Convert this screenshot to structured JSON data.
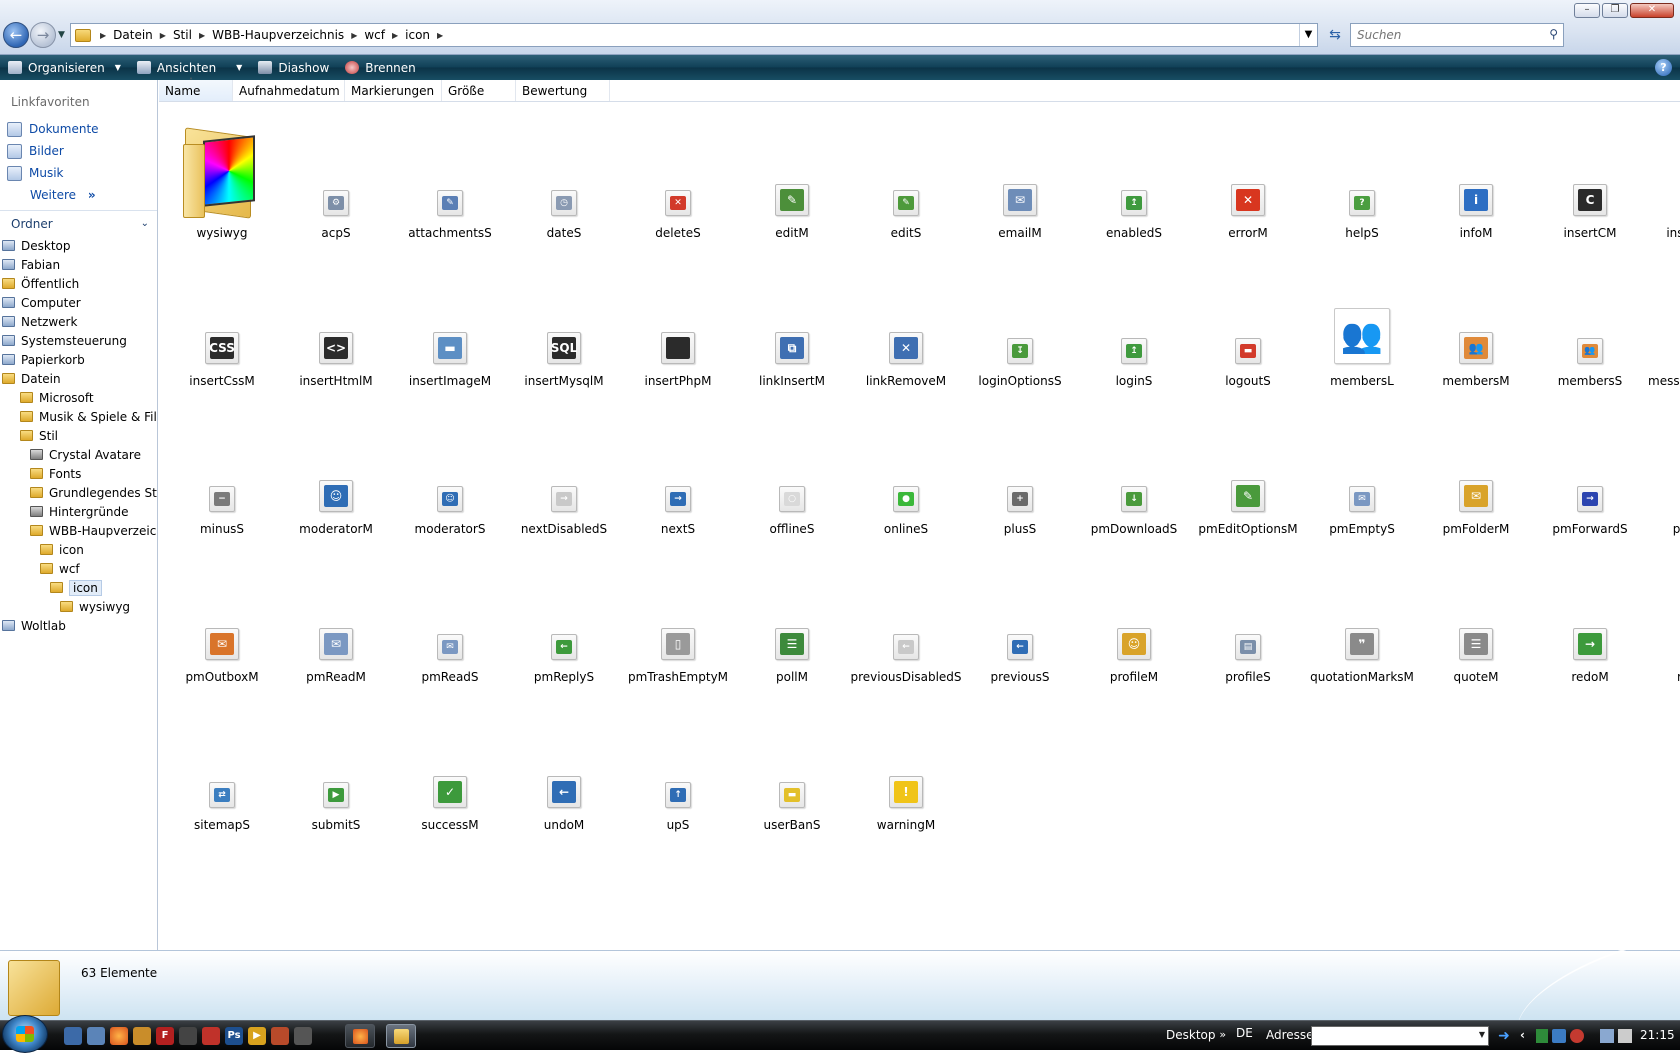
{
  "window": {
    "breadcrumbs": [
      "Datein",
      "Stil",
      "WBB-Haupverzeichnis",
      "wcf",
      "icon"
    ],
    "search_placeholder": "Suchen"
  },
  "toolbar": {
    "organize": "Organisieren",
    "views": "Ansichten",
    "slideshow": "Diashow",
    "burn": "Brennen"
  },
  "sidebar": {
    "favorites_heading": "Linkfavoriten",
    "favorites": [
      {
        "label": "Dokumente",
        "icon": "documents-icon"
      },
      {
        "label": "Bilder",
        "icon": "pictures-icon"
      },
      {
        "label": "Musik",
        "icon": "music-icon"
      }
    ],
    "more_label": "Weitere",
    "more_glyph": "»",
    "folders_heading": "Ordner",
    "tree": [
      {
        "label": "Desktop",
        "indent": 0,
        "icon": "sys"
      },
      {
        "label": "Fabian",
        "indent": 0,
        "icon": "sys"
      },
      {
        "label": "Öffentlich",
        "indent": 0,
        "icon": "folder"
      },
      {
        "label": "Computer",
        "indent": 0,
        "icon": "sys"
      },
      {
        "label": "Netzwerk",
        "indent": 0,
        "icon": "sys"
      },
      {
        "label": "Systemsteuerung",
        "indent": 0,
        "icon": "sys"
      },
      {
        "label": "Papierkorb",
        "indent": 0,
        "icon": "sys"
      },
      {
        "label": "Datein",
        "indent": 0,
        "icon": "folder"
      },
      {
        "label": "Microsoft",
        "indent": 1,
        "icon": "folder"
      },
      {
        "label": "Musik & Spiele & Film",
        "indent": 1,
        "icon": "folder"
      },
      {
        "label": "Stil",
        "indent": 1,
        "icon": "folder"
      },
      {
        "label": "Crystal Avatare",
        "indent": 2,
        "icon": "img"
      },
      {
        "label": "Fonts",
        "indent": 2,
        "icon": "folder"
      },
      {
        "label": "Grundlegendes Stil",
        "indent": 2,
        "icon": "folder"
      },
      {
        "label": "Hintergründe",
        "indent": 2,
        "icon": "img"
      },
      {
        "label": "WBB-Haupverzeichnis",
        "indent": 2,
        "icon": "folder"
      },
      {
        "label": "icon",
        "indent": 3,
        "icon": "folder"
      },
      {
        "label": "wcf",
        "indent": 3,
        "icon": "folder"
      },
      {
        "label": "icon",
        "indent": 4,
        "icon": "folder",
        "selected": true
      },
      {
        "label": "wysiwyg",
        "indent": 5,
        "icon": "folder"
      },
      {
        "label": "Woltlab",
        "indent": 0,
        "icon": "sys"
      }
    ]
  },
  "columns": [
    "Name",
    "Aufnahmedatum",
    "Markierungen",
    "Größe",
    "Bewertung"
  ],
  "files": [
    {
      "name": "wysiwyg",
      "kind": "folder"
    },
    {
      "name": "acpS",
      "color": "#7d8fa8",
      "glyph": "⚙"
    },
    {
      "name": "attachmentsS",
      "color": "#5b7fb5",
      "glyph": "✎"
    },
    {
      "name": "dateS",
      "color": "#8a9ab2",
      "glyph": "◷"
    },
    {
      "name": "deleteS",
      "color": "#d23a2a",
      "glyph": "✕"
    },
    {
      "name": "editM",
      "color": "#4c8f3a",
      "glyph": "✎",
      "size": "m"
    },
    {
      "name": "editS",
      "color": "#4e9a3b",
      "glyph": "✎"
    },
    {
      "name": "emailM",
      "color": "#6e8db8",
      "glyph": "✉",
      "size": "m"
    },
    {
      "name": "enabledS",
      "color": "#3f9a3e",
      "glyph": "↥"
    },
    {
      "name": "errorM",
      "color": "#d8361f",
      "glyph": "✕",
      "size": "m"
    },
    {
      "name": "helpS",
      "color": "#4a9e3f",
      "glyph": "?"
    },
    {
      "name": "infoM",
      "color": "#2d6ec3",
      "glyph": "i",
      "size": "m"
    },
    {
      "name": "insertCM",
      "color": "#2b2b2b",
      "glyph": "C",
      "size": "m"
    },
    {
      "name": "insertCodeM",
      "color": "#2b2b2b",
      "glyph": "#",
      "size": "m"
    },
    {
      "name": "insertCssM",
      "color": "#2b2b2b",
      "glyph": "CSS",
      "size": "m"
    },
    {
      "name": "insertHtmlM",
      "color": "#2b2b2b",
      "glyph": "<>",
      "size": "m"
    },
    {
      "name": "insertImageM",
      "color": "#5d8fc4",
      "glyph": "▬",
      "size": "m"
    },
    {
      "name": "insertMysqlM",
      "color": "#2b2b2b",
      "glyph": "SQL",
      "size": "m"
    },
    {
      "name": "insertPhpM",
      "color": "#2b2b2b",
      "glyph": "<?",
      "size": "m"
    },
    {
      "name": "linkInsertM",
      "color": "#3f6fb2",
      "glyph": "⧉",
      "size": "m"
    },
    {
      "name": "linkRemoveM",
      "color": "#3f6fb2",
      "glyph": "✕",
      "size": "m"
    },
    {
      "name": "loginOptionsS",
      "color": "#4a9a3c",
      "glyph": "↧"
    },
    {
      "name": "loginS",
      "color": "#3f9a3e",
      "glyph": "↥"
    },
    {
      "name": "logoutS",
      "color": "#d23a2a",
      "glyph": "▬"
    },
    {
      "name": "membersL",
      "color": "#e08a3a",
      "glyph": "👥",
      "size": "big"
    },
    {
      "name": "membersM",
      "color": "#e08a3a",
      "glyph": "👥",
      "size": "m"
    },
    {
      "name": "membersS",
      "color": "#e08a3a",
      "glyph": "👥"
    },
    {
      "name": "messageQuoteOpt...",
      "color": "#888888",
      "glyph": "▾"
    },
    {
      "name": "minusS",
      "color": "#7b7b7b",
      "glyph": "−"
    },
    {
      "name": "moderatorM",
      "color": "#2f6db5",
      "glyph": "☺",
      "size": "m"
    },
    {
      "name": "moderatorS",
      "color": "#2f6db5",
      "glyph": "☺"
    },
    {
      "name": "nextDisabledS",
      "color": "#c9c9c9",
      "glyph": "→"
    },
    {
      "name": "nextS",
      "color": "#2f6db5",
      "glyph": "→"
    },
    {
      "name": "offlineS",
      "color": "#d9d9d9",
      "glyph": "○"
    },
    {
      "name": "onlineS",
      "color": "#3bb83a",
      "glyph": "●"
    },
    {
      "name": "plusS",
      "color": "#6b6b6b",
      "glyph": "+"
    },
    {
      "name": "pmDownloadS",
      "color": "#4a9a3c",
      "glyph": "↓"
    },
    {
      "name": "pmEditOptionsM",
      "color": "#4a9a3c",
      "glyph": "✎",
      "size": "m"
    },
    {
      "name": "pmEmptyS",
      "color": "#7b98c2",
      "glyph": "✉"
    },
    {
      "name": "pmFolderM",
      "color": "#d9a32a",
      "glyph": "✉",
      "size": "m"
    },
    {
      "name": "pmForwardS",
      "color": "#2c45b0",
      "glyph": "→"
    },
    {
      "name": "pmInboxM",
      "color": "#3d9a3c",
      "glyph": "✉",
      "size": "m"
    },
    {
      "name": "pmOutboxM",
      "color": "#d9742a",
      "glyph": "✉",
      "size": "m"
    },
    {
      "name": "pmReadM",
      "color": "#7b98c2",
      "glyph": "✉",
      "size": "m"
    },
    {
      "name": "pmReadS",
      "color": "#7b98c2",
      "glyph": "✉"
    },
    {
      "name": "pmReplyS",
      "color": "#3d9a3c",
      "glyph": "←"
    },
    {
      "name": "pmTrashEmptyM",
      "color": "#9a9a9a",
      "glyph": "▯",
      "size": "m"
    },
    {
      "name": "pollM",
      "color": "#3d8a3c",
      "glyph": "☰",
      "size": "m"
    },
    {
      "name": "previousDisabledS",
      "color": "#c9c9c9",
      "glyph": "←"
    },
    {
      "name": "previousS",
      "color": "#2f6db5",
      "glyph": "←"
    },
    {
      "name": "profileM",
      "color": "#d9a32a",
      "glyph": "☺",
      "size": "m"
    },
    {
      "name": "profileS",
      "color": "#7b8faa",
      "glyph": "▤"
    },
    {
      "name": "quotationMarksM",
      "color": "#8a8a8a",
      "glyph": "❞",
      "size": "m"
    },
    {
      "name": "quoteM",
      "color": "#8a8a8a",
      "glyph": "☰",
      "size": "m"
    },
    {
      "name": "redoM",
      "color": "#3d9a3c",
      "glyph": "→",
      "size": "m"
    },
    {
      "name": "registerS",
      "color": "#d9742a",
      "glyph": "✎"
    },
    {
      "name": "sitemapS",
      "color": "#3b7ec0",
      "glyph": "⇄"
    },
    {
      "name": "submitS",
      "color": "#3d9a3c",
      "glyph": "▶"
    },
    {
      "name": "successM",
      "color": "#3d9a3c",
      "glyph": "✓",
      "size": "m"
    },
    {
      "name": "undoM",
      "color": "#2f6db5",
      "glyph": "←",
      "size": "m"
    },
    {
      "name": "upS",
      "color": "#2f6db5",
      "glyph": "↑"
    },
    {
      "name": "userBanS",
      "color": "#e3c02a",
      "glyph": "▬"
    },
    {
      "name": "warningM",
      "color": "#f0c419",
      "glyph": "!",
      "size": "m"
    }
  ],
  "status": {
    "count": "63 Elemente"
  },
  "taskbar": {
    "desktop_label": "Desktop",
    "desktop_chevron": "»",
    "language": "DE",
    "address_label": "Adresse",
    "clock": "21:15",
    "tray_chevron": "‹"
  }
}
